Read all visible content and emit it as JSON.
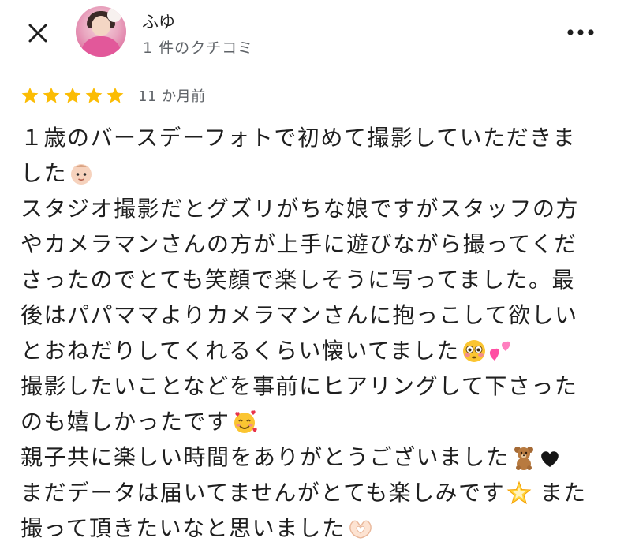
{
  "header": {
    "user_name": "ふゆ",
    "review_count": "1 件のクチコミ"
  },
  "icons": {
    "close": "close-icon",
    "more": "more-vert-icon",
    "star": "star-icon"
  },
  "colors": {
    "star": "#FBBC04",
    "meta_text": "#5f6368",
    "body_text": "#1f1f1f"
  },
  "rating": {
    "stars": 5,
    "date": "11 か月前"
  },
  "review": {
    "lines": [
      "１歳のバースデーフォトで初めて撮影していただきま",
      "した",
      "スタジオ撮影だとグズリがちな娘ですがスタッフの方",
      "やカメラマンさんの方が上手に遊びながら撮ってくだ",
      "さったのでとても笑顔で楽しそうに写ってました。最",
      "後はパパママよりカメラマンさんに抱っこして欲しい",
      "とおねだりしてくれるくらい懐いてました",
      "撮影したいことなどを事前にヒアリングして下さった",
      "のも嬉しかったです",
      "親子共に楽しい時間をありがとうございました",
      "まだデータは届いてませんがとても楽しみです",
      "撮って頂きたいなと思いました"
    ],
    "trailing": {
      "line10_after_emoji": " また"
    },
    "emojis": {
      "baby": "baby-emoji",
      "flushed": "flushed-face-emoji",
      "hearts": "two-hearts-emoji",
      "smiling_hearts": "smiling-face-with-hearts-emoji",
      "bear": "teddy-bear-emoji",
      "heart": "black-heart-emoji",
      "star": "glowing-star-emoji",
      "hands": "heart-hands-emoji"
    }
  }
}
